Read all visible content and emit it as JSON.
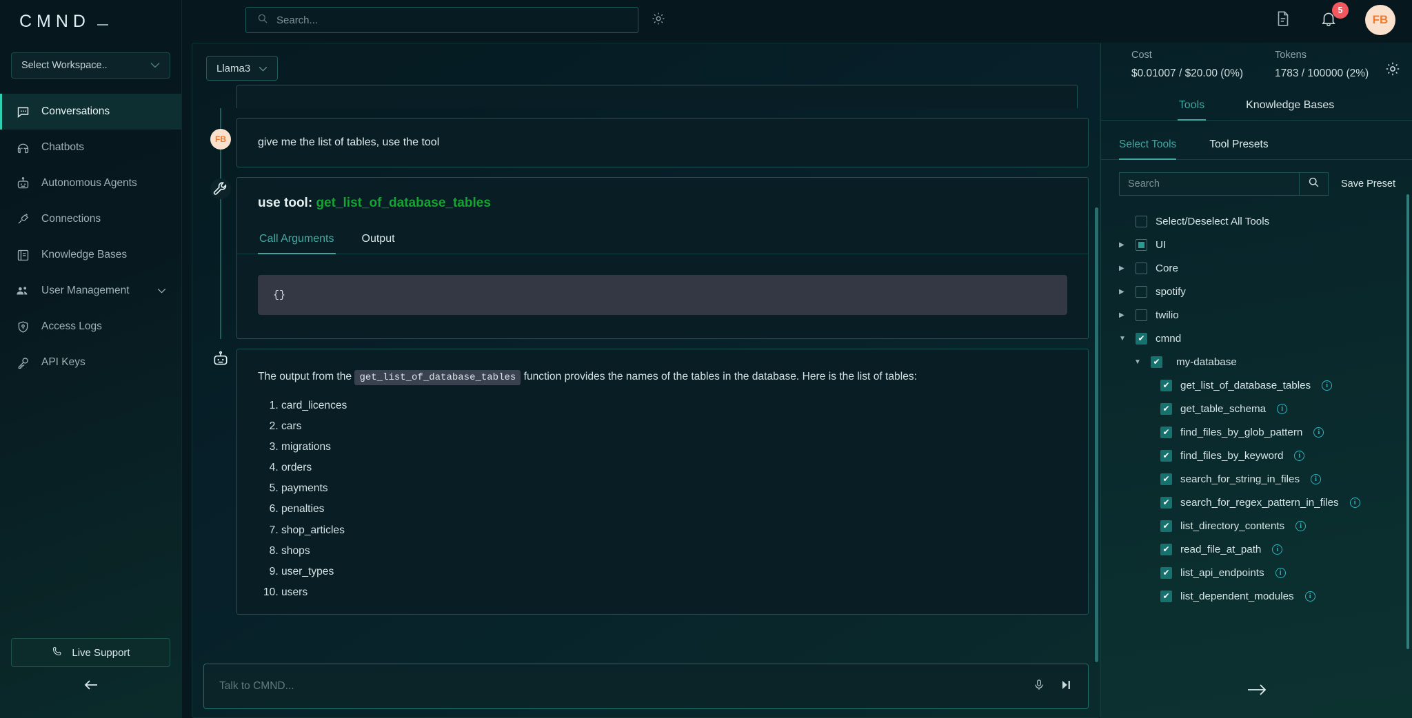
{
  "brand": {
    "logo_text": "CMND"
  },
  "sidebar": {
    "workspace_select": {
      "label": "Select Workspace..",
      "chevron": "chevron-down-icon"
    },
    "items": [
      {
        "label": "Conversations",
        "icon": "chat-bubble-icon",
        "active": true
      },
      {
        "label": "Chatbots",
        "icon": "chatbot-icon",
        "active": false
      },
      {
        "label": "Autonomous Agents",
        "icon": "robot-icon",
        "active": false
      },
      {
        "label": "Connections",
        "icon": "plug-icon",
        "active": false
      },
      {
        "label": "Knowledge Bases",
        "icon": "book-icon",
        "active": false
      },
      {
        "label": "User Management",
        "icon": "users-icon",
        "active": false,
        "chevron": "chevron-down-icon"
      },
      {
        "label": "Access Logs",
        "icon": "shield-icon",
        "active": false
      },
      {
        "label": "API Keys",
        "icon": "key-icon",
        "active": false
      }
    ],
    "live_support": {
      "label": "Live Support",
      "icon": "phone-icon"
    },
    "collapse": {
      "icon": "arrow-left-icon"
    }
  },
  "topbar": {
    "search_placeholder": "Search...",
    "search_value": "",
    "gear": "gear-icon",
    "document_icon": "document-icon",
    "bell_icon": "bell-icon",
    "notification_count": "5",
    "avatar_initials": "FB"
  },
  "chat": {
    "model": {
      "label": "Llama3",
      "chevron": "chevron-down-icon"
    },
    "user_message": {
      "avatar": "FB",
      "text": "give me the list of tables, use the tool"
    },
    "tool_call": {
      "icon": "wrench-icon",
      "prefix": "use tool:",
      "function_name": "get_list_of_database_tables",
      "tabs": [
        {
          "label": "Call Arguments",
          "active": true
        },
        {
          "label": "Output",
          "active": false
        }
      ],
      "arguments": "{}"
    },
    "assistant_message": {
      "icon": "robot-icon",
      "text_before": "The output from the",
      "inline_code": "get_list_of_database_tables",
      "text_after": "function provides the names of the tables in the database. Here is the list of tables:",
      "tables": [
        "card_licences",
        "cars",
        "migrations",
        "orders",
        "payments",
        "penalties",
        "shop_articles",
        "shops",
        "user_types",
        "users"
      ]
    },
    "composer": {
      "placeholder": "Talk to CMND...",
      "value": "",
      "mic_icon": "microphone-icon",
      "skip_icon": "skip-forward-icon"
    }
  },
  "right_panel": {
    "cost": {
      "label": "Cost",
      "value": "$0.01007 / $20.00 (0%)"
    },
    "tokens": {
      "label": "Tokens",
      "value": "1783 / 100000 (2%)"
    },
    "gear": "gear-icon",
    "tabs": [
      {
        "label": "Tools",
        "active": true
      },
      {
        "label": "Knowledge Bases",
        "active": false
      }
    ],
    "sub_tabs": [
      {
        "label": "Select Tools",
        "active": true
      },
      {
        "label": "Tool Presets",
        "active": false
      }
    ],
    "search": {
      "placeholder": "Search",
      "value": "",
      "icon": "search-icon"
    },
    "save_preset_label": "Save Preset",
    "select_all": {
      "label": "Select/Deselect All Tools",
      "state": "unchecked"
    },
    "groups": [
      {
        "label": "UI",
        "state": "indeterminate",
        "expanded": false
      },
      {
        "label": "Core",
        "state": "unchecked",
        "expanded": false
      },
      {
        "label": "spotify",
        "state": "unchecked",
        "expanded": false
      },
      {
        "label": "twilio",
        "state": "unchecked",
        "expanded": false
      },
      {
        "label": "cmnd",
        "state": "checked",
        "expanded": true
      }
    ],
    "sub_group": {
      "label": "my-database",
      "state": "checked",
      "expanded": true
    },
    "tools": [
      {
        "label": "get_list_of_database_tables",
        "state": "checked",
        "info": "info-icon"
      },
      {
        "label": "get_table_schema",
        "state": "checked",
        "info": "info-icon"
      },
      {
        "label": "find_files_by_glob_pattern",
        "state": "checked",
        "info": "info-icon"
      },
      {
        "label": "find_files_by_keyword",
        "state": "checked",
        "info": "info-icon"
      },
      {
        "label": "search_for_string_in_files",
        "state": "checked",
        "info": "info-icon"
      },
      {
        "label": "search_for_regex_pattern_in_files",
        "state": "checked",
        "info": "info-icon"
      },
      {
        "label": "list_directory_contents",
        "state": "checked",
        "info": "info-icon"
      },
      {
        "label": "read_file_at_path",
        "state": "checked",
        "info": "info-icon"
      },
      {
        "label": "list_api_endpoints",
        "state": "checked",
        "info": "info-icon"
      },
      {
        "label": "list_dependent_modules",
        "state": "checked",
        "info": "info-icon"
      }
    ],
    "send": {
      "icon": "arrow-right-icon"
    }
  },
  "colors": {
    "accent_teal": "#3fa8a1",
    "checkbox_teal": "#16726e",
    "function_green": "#17a333",
    "badge_red": "#f4585f",
    "avatar_bg": "#fae1cd",
    "avatar_fg": "#ef7a30"
  }
}
